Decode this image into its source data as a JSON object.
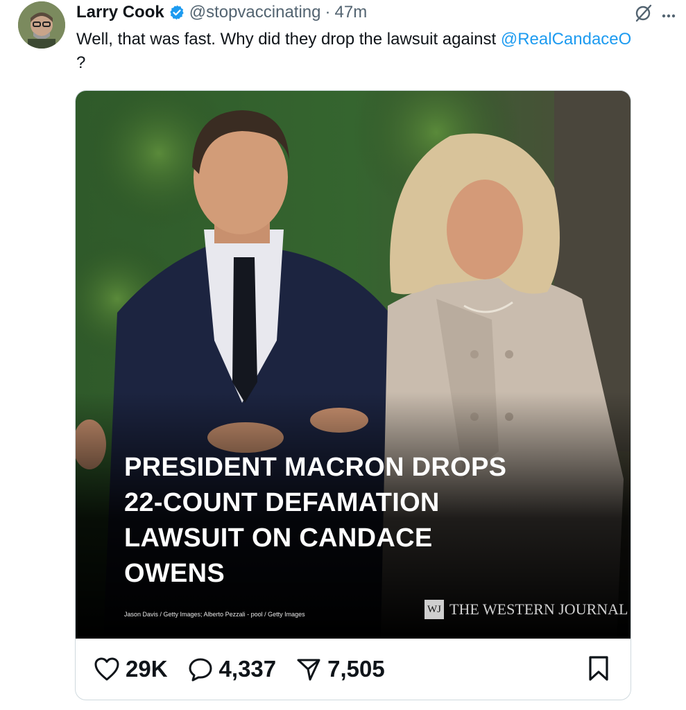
{
  "post": {
    "author_name": "Larry Cook",
    "handle": "@stopvaccinating",
    "separator": "·",
    "time": "47m",
    "text_before": "Well, that was fast. Why did they drop the lawsuit against ",
    "mention": "@RealCandaceO",
    "text_after": "?"
  },
  "media": {
    "headline_lines": [
      "PRESIDENT MACRON DROPS",
      "22-COUNT DEFAMATION",
      "LAWSUIT ON CANDACE",
      "OWENS"
    ],
    "credit": "Jason Davis / Getty Images; Alberto Pezzali - pool / Getty Images",
    "brand_logo": "WJ",
    "brand_name": "THE WESTERN JOURNAL"
  },
  "actions": {
    "likes": "29K",
    "replies": "4,337",
    "reposts": "7,505"
  },
  "icons": {
    "verified": "verified-badge-icon",
    "grok": "grok-icon",
    "more": "more-icon",
    "like": "heart-icon",
    "reply": "reply-icon",
    "share": "share-icon",
    "bookmark": "bookmark-icon"
  },
  "colors": {
    "accent": "#1d9bf0",
    "text": "#0f1419",
    "muted": "#536471"
  }
}
